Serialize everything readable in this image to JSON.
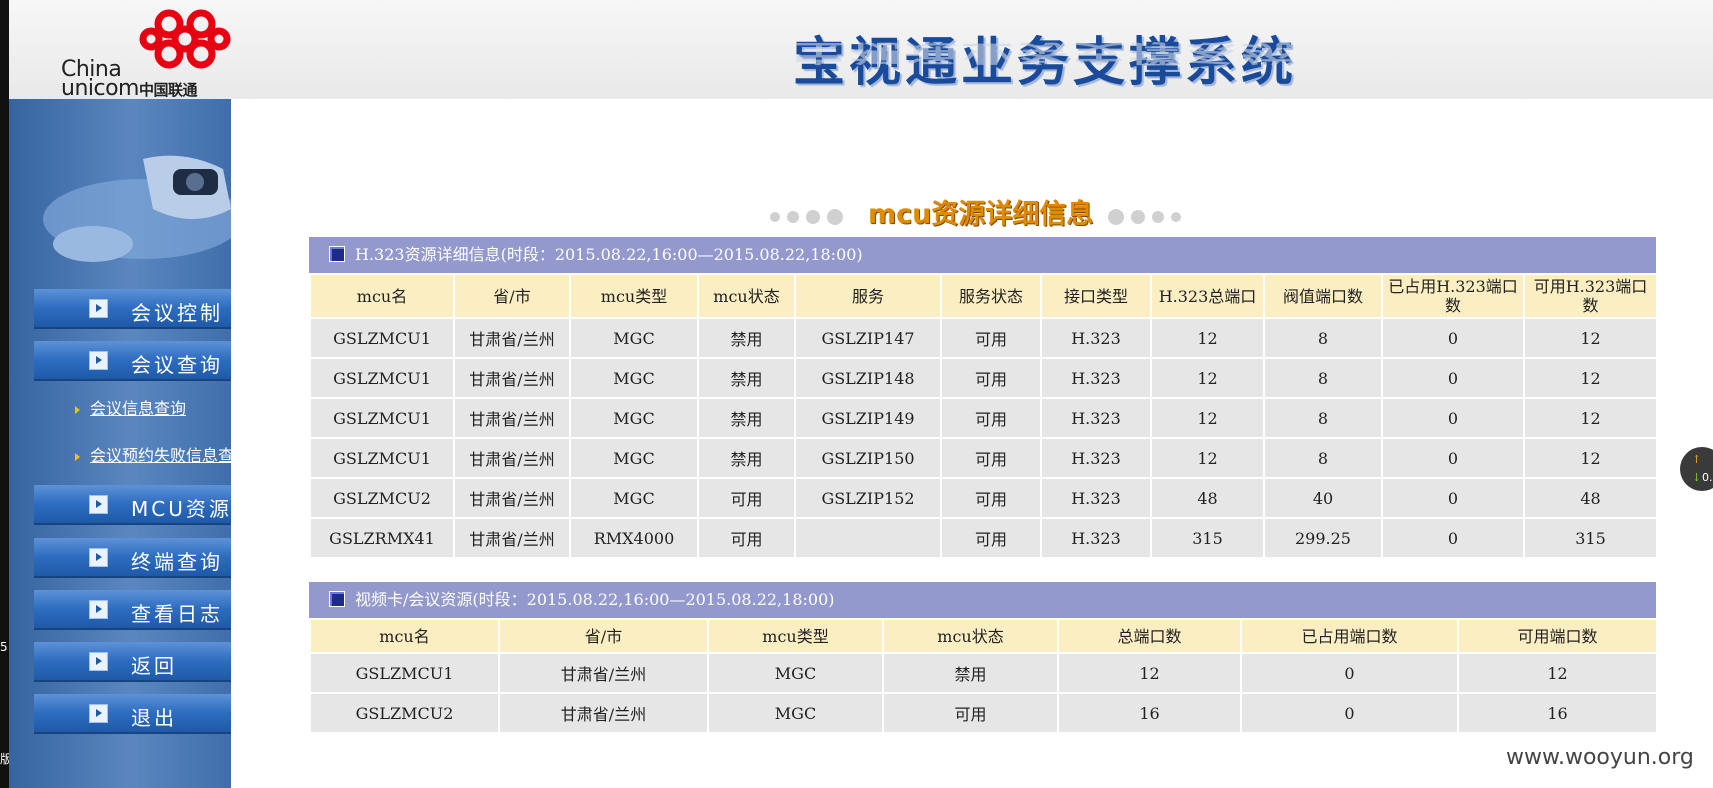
{
  "header": {
    "logo_text_en_1": "China",
    "logo_text_en_2": "unicom",
    "logo_text_cn": "中国联通",
    "system_title": "宝视通业务支撑系统"
  },
  "sidebar": {
    "items": [
      {
        "label": "会议控制"
      },
      {
        "label": "会议查询"
      },
      {
        "label": "MCU资源"
      },
      {
        "label": "终端查询"
      },
      {
        "label": "查看日志"
      },
      {
        "label": "返回"
      },
      {
        "label": "退出"
      }
    ],
    "sub_links": [
      {
        "label": "会议信息查询"
      },
      {
        "label": "会议预约失败信息查"
      }
    ]
  },
  "page_heading": "mcu资源详细信息",
  "h323_panel": {
    "title": "H.323资源详细信息(时段：2015.08.22,16:00—2015.08.22,18:00)",
    "columns": [
      "mcu名",
      "省/市",
      "mcu类型",
      "mcu状态",
      "服务",
      "服务状态",
      "接口类型",
      "H.323总端口",
      "阀值端口数",
      "已占用H.323端口数",
      "可用H.323端口数"
    ],
    "rows": [
      [
        "GSLZMCU1",
        "甘肃省/兰州",
        "MGC",
        "禁用",
        "GSLZIP147",
        "可用",
        "H.323",
        "12",
        "8",
        "0",
        "12"
      ],
      [
        "GSLZMCU1",
        "甘肃省/兰州",
        "MGC",
        "禁用",
        "GSLZIP148",
        "可用",
        "H.323",
        "12",
        "8",
        "0",
        "12"
      ],
      [
        "GSLZMCU1",
        "甘肃省/兰州",
        "MGC",
        "禁用",
        "GSLZIP149",
        "可用",
        "H.323",
        "12",
        "8",
        "0",
        "12"
      ],
      [
        "GSLZMCU1",
        "甘肃省/兰州",
        "MGC",
        "禁用",
        "GSLZIP150",
        "可用",
        "H.323",
        "12",
        "8",
        "0",
        "12"
      ],
      [
        "GSLZMCU2",
        "甘肃省/兰州",
        "MGC",
        "可用",
        "GSLZIP152",
        "可用",
        "H.323",
        "48",
        "40",
        "0",
        "48"
      ],
      [
        "GSLZRMX41",
        "甘肃省/兰州",
        "RMX4000",
        "可用",
        "",
        "可用",
        "H.323",
        "315",
        "299.25",
        "0",
        "315"
      ]
    ]
  },
  "video_panel": {
    "title": "视频卡/会议资源(时段：2015.08.22,16:00—2015.08.22,18:00)",
    "columns": [
      "mcu名",
      "省/市",
      "mcu类型",
      "mcu状态",
      "总端口数",
      "已占用端口数",
      "可用端口数"
    ],
    "rows": [
      [
        "GSLZMCU1",
        "甘肃省/兰州",
        "MGC",
        "禁用",
        "12",
        "0",
        "12"
      ],
      [
        "GSLZMCU2",
        "甘肃省/兰州",
        "MGC",
        "可用",
        "16",
        "0",
        "16"
      ]
    ]
  },
  "watermark": "www.wooyun.org",
  "float_widget": {
    "value": "0."
  },
  "edge_texts": [
    "5",
    "版"
  ],
  "colors": {
    "panel_header": "#9399cc",
    "table_header": "#fbeec2",
    "cell": "#e6e6e6",
    "sidebar": "#4a78b4",
    "title": "#1a4b9a",
    "heading": "#e08a00"
  }
}
